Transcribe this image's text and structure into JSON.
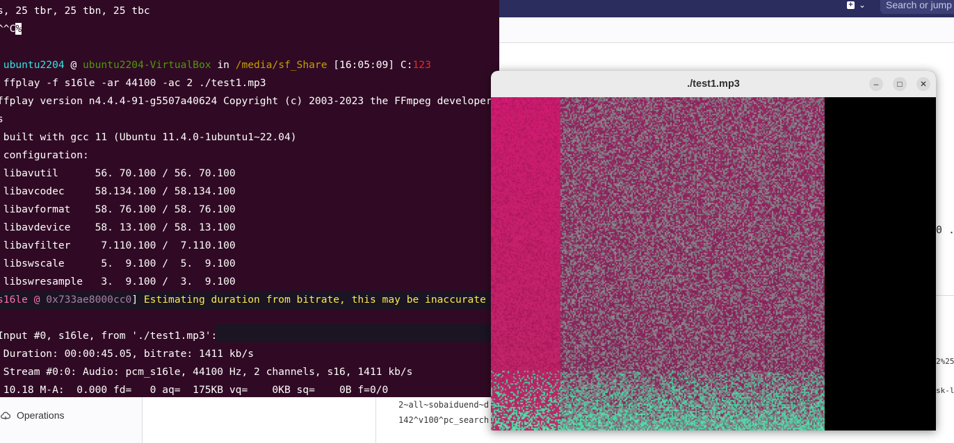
{
  "background_app": {
    "header": {
      "plus_label": "+",
      "dropdown_caret": "⌄",
      "search_placeholder": "Search or jump"
    },
    "right_fragments": {
      "mid": "0 .",
      "percent": "2%25",
      "sk": "sk-l"
    },
    "bottom_fragments": {
      "line1": "2~all~sobaiduend~d",
      "line2": "142^v100^pc_search"
    },
    "sidebar": {
      "operations_label": "Operations",
      "operations_icon": "cloud-icon"
    }
  },
  "terminal": {
    "lines": [
      {
        "text": "s, 25 tbr, 25 tbn, 25 tbc"
      },
      {
        "text": "^^C",
        "cursor": "%"
      },
      {
        "text": ""
      },
      {
        "prompt": {
          "user": " ubuntu2204",
          "at": " @ ",
          "host": "ubuntu2204-VirtualBox",
          "in": " in ",
          "path": "/media/sf_Share",
          "time": " [16:05:09] C:",
          "code": "123"
        }
      },
      {
        "text": " ffplay -f s16le -ar 44100 -ac 2 ./test1.mp3"
      },
      {
        "text": "ffplay version n4.4.4-91-g5507a40624 Copyright (c) 2003-2023 the FFmpeg developers"
      },
      {
        "text": "s"
      },
      {
        "text": " built with gcc 11 (Ubuntu 11.4.0-1ubuntu1~22.04)"
      },
      {
        "text": " configuration:"
      },
      {
        "text": " libavutil      56. 70.100 / 56. 70.100"
      },
      {
        "text": " libavcodec     58.134.100 / 58.134.100"
      },
      {
        "text": " libavformat    58. 76.100 / 58. 76.100"
      },
      {
        "text": " libavdevice    58. 13.100 / 58. 13.100"
      },
      {
        "text": " libavfilter     7.110.100 /  7.110.100"
      },
      {
        "text": " libswscale      5.  9.100 /  5.  9.100"
      },
      {
        "text": " libswresample   3.  9.100 /  3.  9.100"
      },
      {
        "warn": {
          "prefix": "s16le @ ",
          "addr": "0x733ae8000cc0",
          "suffix": "] ",
          "message": "Estimating duration from bitrate, this may be inaccurate"
        }
      },
      {
        "text": ""
      },
      {
        "text": "Input #0, s16le, from './test1.mp3':"
      },
      {
        "text": " Duration: 00:00:45.05, bitrate: 1411 kb/s"
      },
      {
        "text": " Stream #0:0: Audio: pcm_s16le, 44100 Hz, 2 channels, s16, 1411 kb/s"
      },
      {
        "text": " 10.18 M-A:  0.000 fd=   0 aq=  175KB vq=    0KB sq=    0B f=0/0"
      }
    ],
    "colors": {
      "bg": "#300a24",
      "user": "#34e2e2",
      "host": "#4e9a06",
      "path": "#c4a000",
      "code": "#ef2929",
      "warn": "#fce94f"
    }
  },
  "ffplay": {
    "title": "./test1.mp3",
    "controls": {
      "minimize": "–",
      "maximize": "□",
      "close": "✕"
    },
    "visualization": "spectrogram"
  }
}
